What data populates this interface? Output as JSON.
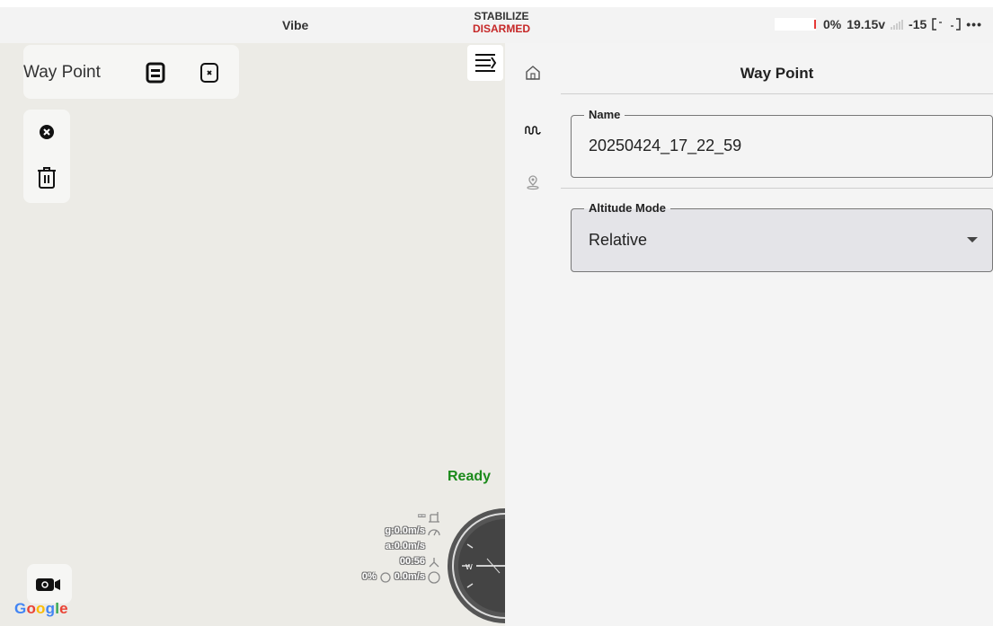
{
  "status_bar": {
    "vehicle_name": "Vibe",
    "flight_mode": "STABILIZE",
    "arm_state": "DISARMED",
    "battery_percent": "0%",
    "voltage": "19.15v",
    "signal_value": "-15",
    "more_label": "•••"
  },
  "map_toolbar": {
    "title": "Way Point",
    "save_icon": "save-icon",
    "close_icon": "close-square-icon"
  },
  "side_tools": {
    "clear_icon": "cancel-circle-icon",
    "delete_icon": "trash-icon"
  },
  "map": {
    "ready_text": "Ready",
    "provider_label": "Google",
    "colors": {
      "ready": "#1b8a1b",
      "map_bg": "#ecebe6"
    }
  },
  "telemetry": {
    "altitude": "--",
    "ground_speed": "g:0.0m/s",
    "air_speed": "a:0.0m/s",
    "flight_time": "00:56",
    "throttle": "0%",
    "vertical_speed": "0.0m/s"
  },
  "compass": {
    "heading_label": "W"
  },
  "panel": {
    "title": "Way Point",
    "nav": [
      "home-icon",
      "waveform-icon",
      "location-pin-icon"
    ],
    "name_field": {
      "label": "Name",
      "value": "20250424_17_22_59"
    },
    "altitude_mode": {
      "label": "Altitude Mode",
      "value": "Relative"
    }
  },
  "colors": {
    "disarmed": "#c62828",
    "panel_bg": "#f4f4f4"
  }
}
